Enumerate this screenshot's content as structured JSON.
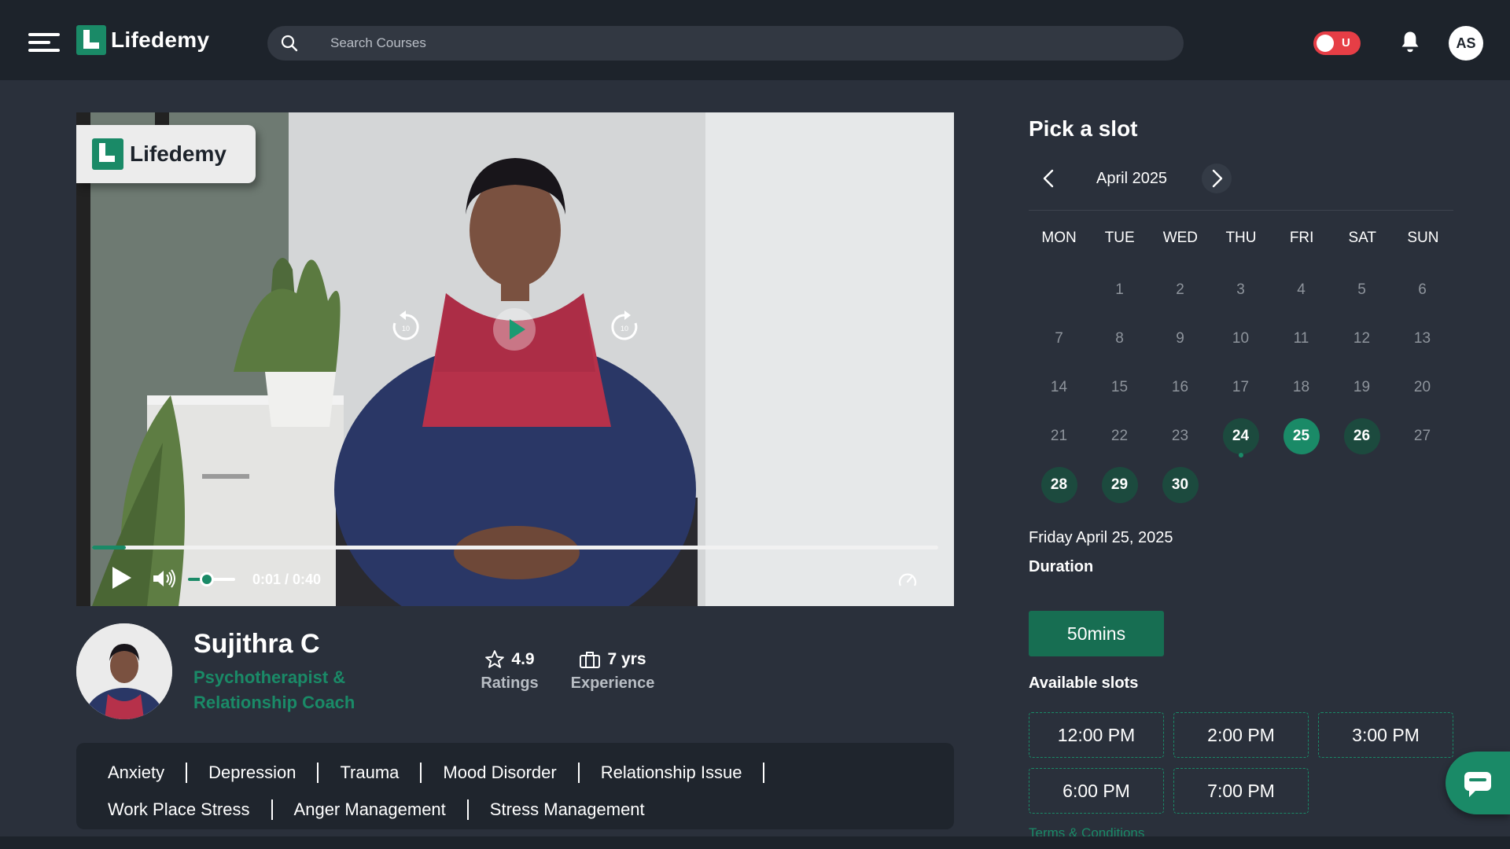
{
  "header": {
    "brand": "Lifedemy",
    "search_placeholder": "Search Courses",
    "toggle_label": "U",
    "avatar_initials": "AS"
  },
  "video": {
    "watermark": "Lifedemy",
    "time": "0:01 / 0:40",
    "progress_fraction": 0.04,
    "volume_fraction": 0.4
  },
  "profile": {
    "name": "Sujithra C",
    "role": "Psychotherapist & Relationship Coach",
    "rating": "4.9",
    "rating_label": "Ratings",
    "experience": "7 yrs",
    "experience_label": "Experience"
  },
  "tags_row1": [
    "Anxiety",
    "Depression",
    "Trauma",
    "Mood Disorder",
    "Relationship Issue"
  ],
  "tags_row2": [
    "Work Place Stress",
    "Anger Management",
    "Stress Management"
  ],
  "booking": {
    "title": "Pick a slot",
    "month": "April 2025",
    "weekdays": [
      "MON",
      "TUE",
      "WED",
      "THU",
      "FRI",
      "SAT",
      "SUN"
    ],
    "first_weekday_offset": 1,
    "days_in_month": 30,
    "available_days": [
      24,
      25,
      26,
      28,
      29,
      30
    ],
    "selected_day": 25,
    "today_day": 24,
    "selected_date_text": "Friday April 25, 2025",
    "duration_label": "Duration",
    "duration_value": "50mins",
    "available_slots_label": "Available slots",
    "slots": [
      "12:00 PM",
      "2:00 PM",
      "3:00 PM",
      "6:00 PM",
      "7:00 PM"
    ],
    "terms": "Terms & Conditions"
  },
  "colors": {
    "accent": "#1a8a67",
    "background": "#2a303b",
    "topbar": "#1d232b",
    "toggle": "#e63e46"
  }
}
